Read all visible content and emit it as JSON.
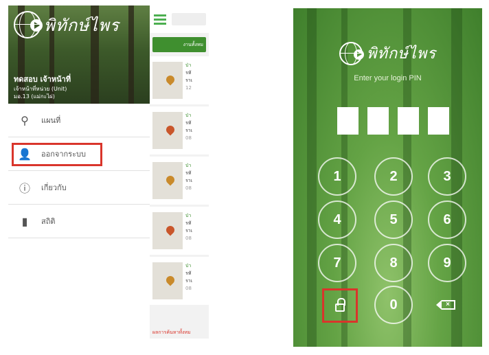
{
  "left": {
    "logo_text": "พิทักษ์ไพร",
    "user": {
      "name": "ทดสอบ เจ้าหน้าที่",
      "unit": "เจ้าหน้าที่หน่วย (Unit)",
      "station": "มอ.13 (แม่กะไผ่)"
    },
    "menu": [
      {
        "label": "แผนที่",
        "icon": "map-pin-icon"
      },
      {
        "label": "ออกจากระบบ",
        "icon": "user-icon"
      },
      {
        "label": "เกี่ยวกับ",
        "icon": "info-icon"
      },
      {
        "label": "สถิติ",
        "icon": "bar-chart-icon"
      }
    ],
    "list": {
      "filter_label": "งานทั้งหม",
      "cards": [
        {
          "l1": "ป่า",
          "l2": "รหั",
          "l3": "ราเ",
          "l4": "12"
        },
        {
          "l1": "ป่า",
          "l2": "รหั",
          "l3": "ราเ",
          "l4": "08"
        },
        {
          "l1": "ป่า",
          "l2": "รหั",
          "l3": "ราเ",
          "l4": "08"
        },
        {
          "l1": "ป่า",
          "l2": "รหั",
          "l3": "ราเ",
          "l4": "08"
        },
        {
          "l1": "ป่า",
          "l2": "รหั",
          "l3": "ราเ",
          "l4": "08"
        }
      ],
      "footer": "ผลการค้นหาทั้งหม"
    }
  },
  "right": {
    "logo_text": "พิทักษ์ไพร",
    "prompt": "Enter your login PIN",
    "keys": [
      "1",
      "2",
      "3",
      "4",
      "5",
      "6",
      "7",
      "8",
      "9",
      "",
      "0",
      ""
    ]
  },
  "colors": {
    "accent_green": "#3f8f2f",
    "highlight_red": "#d9352b"
  }
}
